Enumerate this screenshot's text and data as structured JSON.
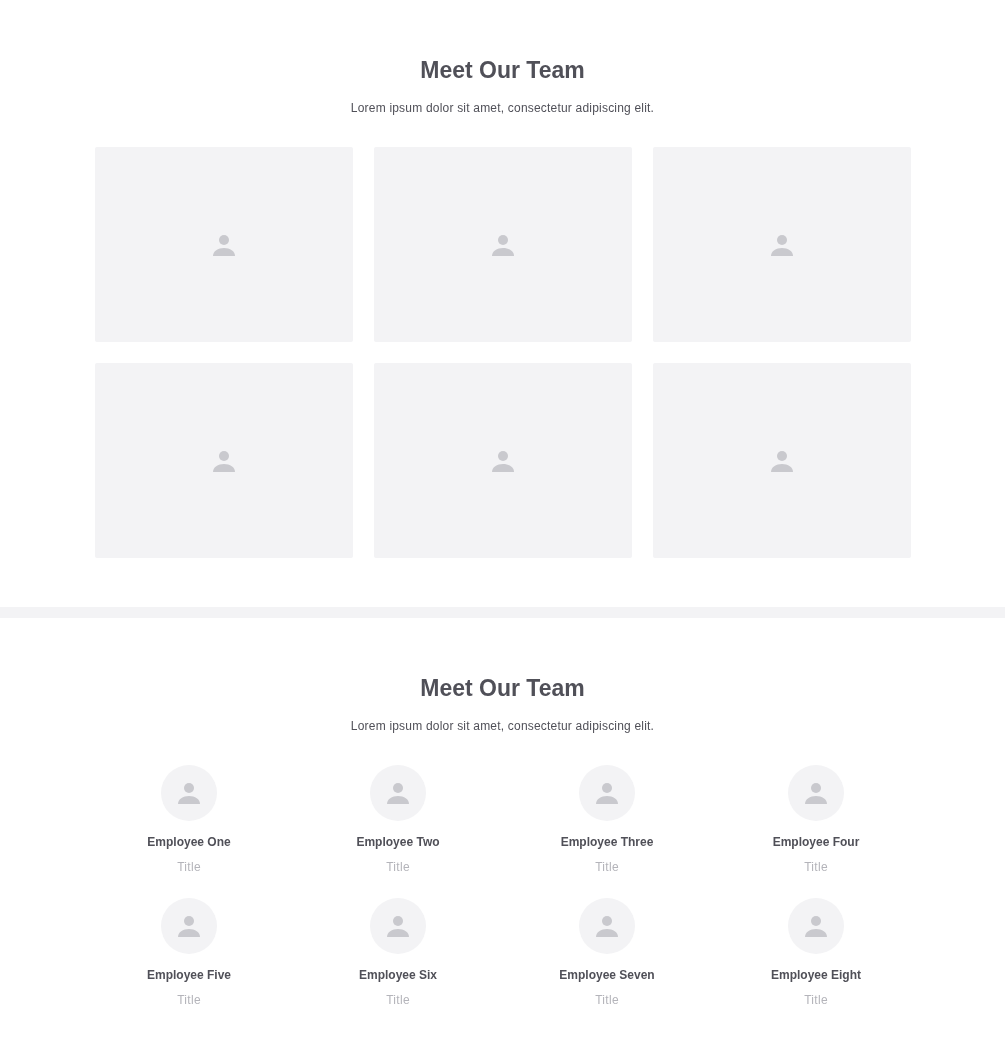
{
  "sections": [
    {
      "title": "Meet Our Team",
      "subtitle": "Lorem ipsum dolor sit amet, consectetur adipiscing elit.",
      "kind": "photo_grid",
      "cards": [
        {
          "kind": "placeholder"
        },
        {
          "kind": "placeholder"
        },
        {
          "kind": "placeholder"
        },
        {
          "kind": "placeholder"
        },
        {
          "kind": "placeholder"
        },
        {
          "kind": "placeholder"
        }
      ]
    },
    {
      "title": "Meet Our Team",
      "subtitle": "Lorem ipsum dolor sit amet, consectetur adipiscing elit.",
      "kind": "members",
      "members": [
        {
          "name": "Employee One",
          "title": "Title"
        },
        {
          "name": "Employee Two",
          "title": "Title"
        },
        {
          "name": "Employee Three",
          "title": "Title"
        },
        {
          "name": "Employee Four",
          "title": "Title"
        },
        {
          "name": "Employee Five",
          "title": "Title"
        },
        {
          "name": "Employee Six",
          "title": "Title"
        },
        {
          "name": "Employee Seven",
          "title": "Title"
        },
        {
          "name": "Employee Eight",
          "title": "Title"
        }
      ]
    }
  ]
}
